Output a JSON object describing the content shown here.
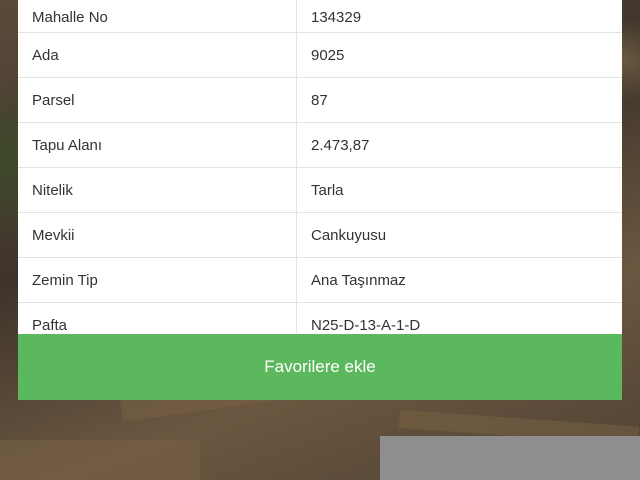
{
  "parcel_info": {
    "rows": [
      {
        "label": "Mahalle No",
        "value": "134329"
      },
      {
        "label": "Ada",
        "value": "9025"
      },
      {
        "label": "Parsel",
        "value": "87"
      },
      {
        "label": "Tapu Alanı",
        "value": "2.473,87"
      },
      {
        "label": "Nitelik",
        "value": "Tarla"
      },
      {
        "label": "Mevkii",
        "value": "Cankuyusu"
      },
      {
        "label": "Zemin Tip",
        "value": "Ana Taşınmaz"
      },
      {
        "label": "Pafta",
        "value": "N25-D-13-A-1-D"
      }
    ]
  },
  "actions": {
    "add_favorites_label": "Favorilere ekle"
  },
  "colors": {
    "button_green": "#5cb85c",
    "card_background": "#ffffff",
    "text": "#333333"
  }
}
